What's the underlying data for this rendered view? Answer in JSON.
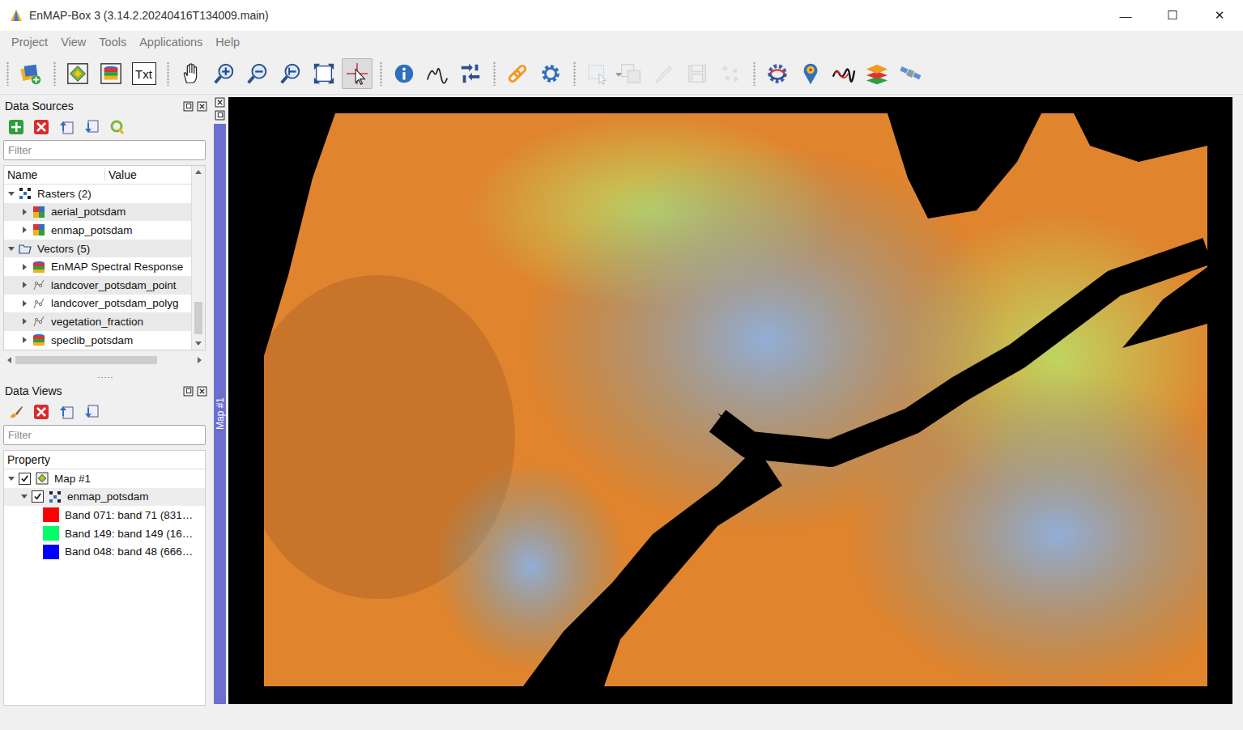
{
  "window": {
    "title": "EnMAP-Box 3 (3.14.2.20240416T134009.main)",
    "controls": [
      "—",
      "☐",
      "✕"
    ]
  },
  "menu": [
    "Project",
    "View",
    "Tools",
    "Applications",
    "Help"
  ],
  "toolbar": {
    "groups": [
      [
        {
          "selected": false,
          "disabled": false
        }
      ],
      [
        {
          "selected": false,
          "disabled": false
        },
        {
          "selected": false,
          "disabled": false
        },
        {
          "selected": false,
          "disabled": false,
          "label": "Txt"
        }
      ],
      [
        {
          "selected": false,
          "disabled": false
        },
        {
          "selected": false,
          "disabled": false
        },
        {
          "selected": false,
          "disabled": false
        },
        {
          "selected": false,
          "disabled": false
        },
        {
          "selected": false,
          "disabled": false
        },
        {
          "selected": true,
          "disabled": false
        }
      ],
      [
        {
          "selected": false,
          "disabled": false
        },
        {
          "selected": false,
          "disabled": false
        },
        {
          "selected": false,
          "disabled": false
        }
      ],
      [
        {
          "selected": false,
          "disabled": false
        },
        {
          "selected": false,
          "disabled": false
        }
      ],
      [
        {
          "selected": false,
          "disabled": true
        },
        {
          "selected": false,
          "disabled": true
        },
        {
          "selected": false,
          "disabled": true
        },
        {
          "selected": false,
          "disabled": true
        },
        {
          "selected": false,
          "disabled": true
        }
      ],
      [
        {
          "selected": false,
          "disabled": false
        },
        {
          "selected": false,
          "disabled": false
        },
        {
          "selected": false,
          "disabled": false
        },
        {
          "selected": false,
          "disabled": false
        },
        {
          "selected": false,
          "disabled": false
        }
      ]
    ]
  },
  "data_sources": {
    "title": "Data Sources",
    "filter_placeholder": "Filter",
    "columns": [
      "Name",
      "Value"
    ],
    "tree": [
      {
        "label": "Rasters (2)",
        "kind": "raster-group",
        "expanded": true,
        "children": [
          {
            "label": "aerial_potsdam",
            "kind": "raster",
            "expanded": false
          },
          {
            "label": "enmap_potsdam",
            "kind": "raster",
            "expanded": false
          }
        ]
      },
      {
        "label": "Vectors (5)",
        "kind": "vector-group",
        "expanded": true,
        "children": [
          {
            "label": "EnMAP Spectral Response",
            "kind": "speclib",
            "expanded": false
          },
          {
            "label": "landcover_potsdam_point",
            "kind": "vector",
            "expanded": false
          },
          {
            "label": "landcover_potsdam_polyg",
            "kind": "vector",
            "expanded": false
          },
          {
            "label": "vegetation_fraction",
            "kind": "vector",
            "expanded": false
          },
          {
            "label": "speclib_potsdam",
            "kind": "speclib",
            "expanded": false
          }
        ]
      }
    ]
  },
  "data_views": {
    "title": "Data Views",
    "filter_placeholder": "Filter",
    "column": "Property",
    "tree": [
      {
        "label": "Map #1",
        "expanded": true,
        "checked": true,
        "children": [
          {
            "label": "enmap_potsdam",
            "expanded": true,
            "checked": true,
            "bands": [
              {
                "label": "Band 071: band 71 (831…",
                "color": "#ff0000"
              },
              {
                "label": "Band 149: band 149 (16…",
                "color": "#00ff66"
              },
              {
                "label": "Band 048: band 48 (666…",
                "color": "#0000ff"
              }
            ]
          }
        ]
      }
    ]
  },
  "map_tab": {
    "label": "Map #1"
  },
  "status_bar": {
    "text": ""
  }
}
